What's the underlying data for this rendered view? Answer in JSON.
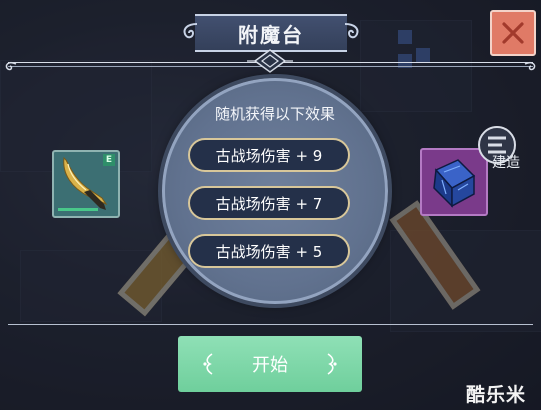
{
  "header": {
    "title": "附魔台"
  },
  "effects": {
    "heading": "随机获得以下效果",
    "items": [
      {
        "label": "古战场伤害 + 9"
      },
      {
        "label": "古战场伤害 + 7"
      },
      {
        "label": "古战场伤害 + 5"
      }
    ]
  },
  "slots": {
    "weapon": {
      "badge": "E",
      "icon": "golden-dagger-icon"
    },
    "gem": {
      "icon": "blue-gem-cube-icon"
    }
  },
  "build": {
    "label": "建造"
  },
  "actions": {
    "start_label": "开始",
    "close_icon": "close-icon"
  },
  "watermark": "酷乐米",
  "colors": {
    "pill_border": "#d8c79a",
    "start_button": "#78d4a6",
    "close_button": "#e07a66",
    "disc": "#6f809c"
  }
}
